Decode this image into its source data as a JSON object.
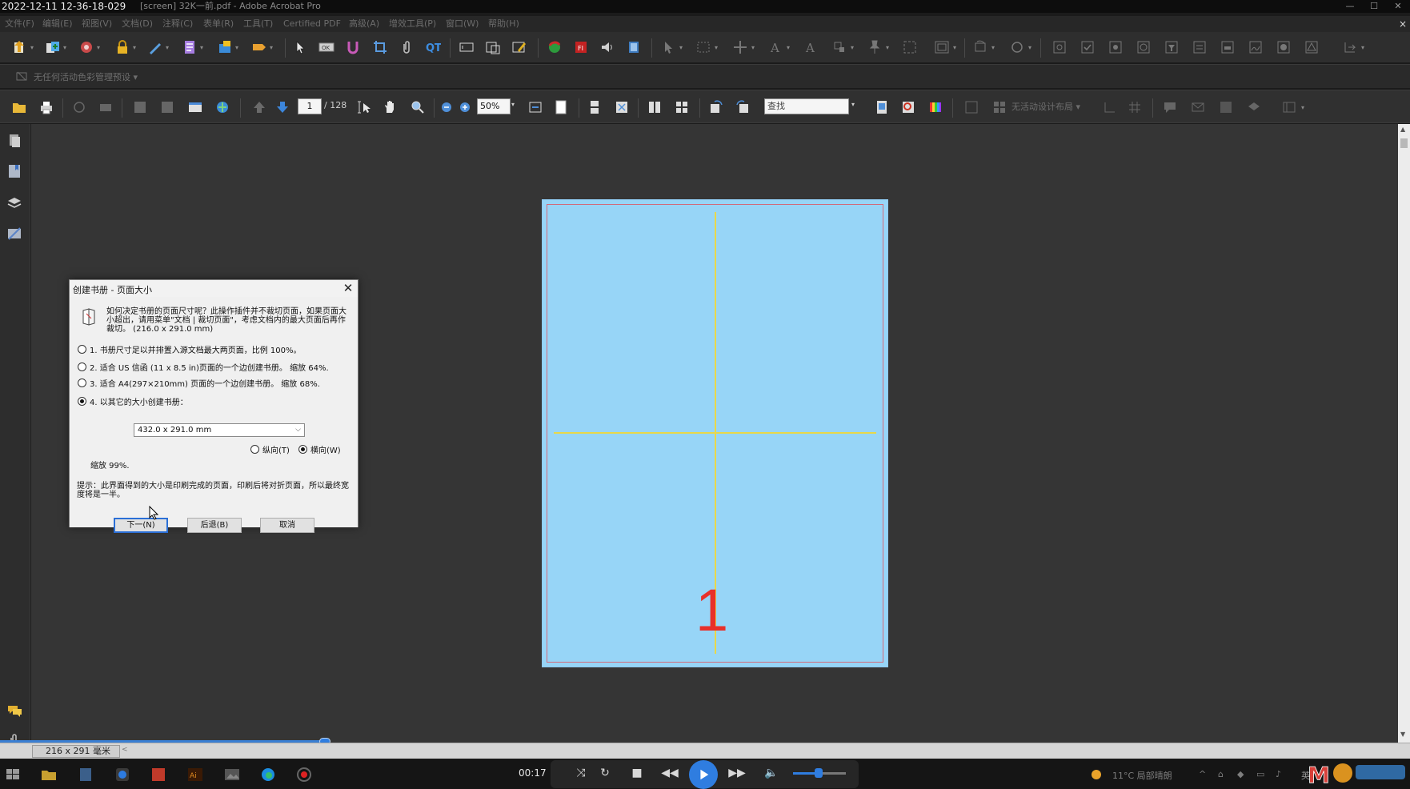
{
  "titlebar": {
    "timestamp": "2022-12-11 12-36-18-029",
    "app_title": "[screen] 32K一前.pdf - Adobe Acrobat Pro"
  },
  "menu": {
    "items": [
      "文件(F)",
      "编辑(E)",
      "视图(V)",
      "文档(D)",
      "注释(C)",
      "表单(R)",
      "工具(T)",
      "Certified PDF",
      "高级(A)",
      "增效工具(P)",
      "窗口(W)",
      "帮助(H)"
    ],
    "close_glyph": "×"
  },
  "toolbar_colormanagement": {
    "label": "无任何活动色彩管理预设 ▾"
  },
  "navigation": {
    "current_page": "1",
    "total_pages": "/ 128",
    "zoom": "50%",
    "find_placeholder": "查找",
    "layout_label": "无活动设计布局 ▾"
  },
  "document": {
    "page_number": "1"
  },
  "statusbar": {
    "page_size": "216 x 291 毫米",
    "scroll_left": "<"
  },
  "dialog": {
    "title": "创建书册 - 页面大小",
    "question": "如何决定书册的页面尺寸呢？此操作插件并不裁切页面，如果页面大小超出，请用菜单\"文档 | 裁切页面\"，考虑文档内的最大页面后再作裁切。 (216.0 x 291.0 mm)",
    "options": [
      {
        "label": "1. 书册尺寸足以并排置入源文档最大两页面，比例 100%。",
        "selected": false
      },
      {
        "label": "2. 适合 US 信函 (11 x 8.5 in)页面的一个边创建书册。 缩放 64%.",
        "selected": false
      },
      {
        "label": "3. 适合 A4(297×210mm) 页面的一个边创建书册。 缩放 68%.",
        "selected": false
      },
      {
        "label": "4. 以其它的大小创建书册：",
        "selected": true
      }
    ],
    "size_select": "432.0 x 291.0 mm",
    "orientation_portrait": "纵向(T)",
    "orientation_landscape": "横向(W)",
    "orientation_selected": "landscape",
    "scale": "缩放 99%.",
    "hint": "提示：此界面得到的大小是印刷完成的页面，印刷后将对折页面，所以最终宽度将是一半。",
    "buttons": {
      "next": "下一(N)",
      "back": "后退(B)",
      "cancel": "取消"
    }
  },
  "player": {
    "time": "00:17",
    "progress": 0.23,
    "volume": 0.5
  },
  "tray": {
    "weather": "11°C 局部晴朗",
    "ime": "英"
  },
  "colors": {
    "page_fill": "#97d5f7",
    "guide": "#e8d84a",
    "page_number": "#e8302a",
    "accent": "#2f7de0"
  }
}
